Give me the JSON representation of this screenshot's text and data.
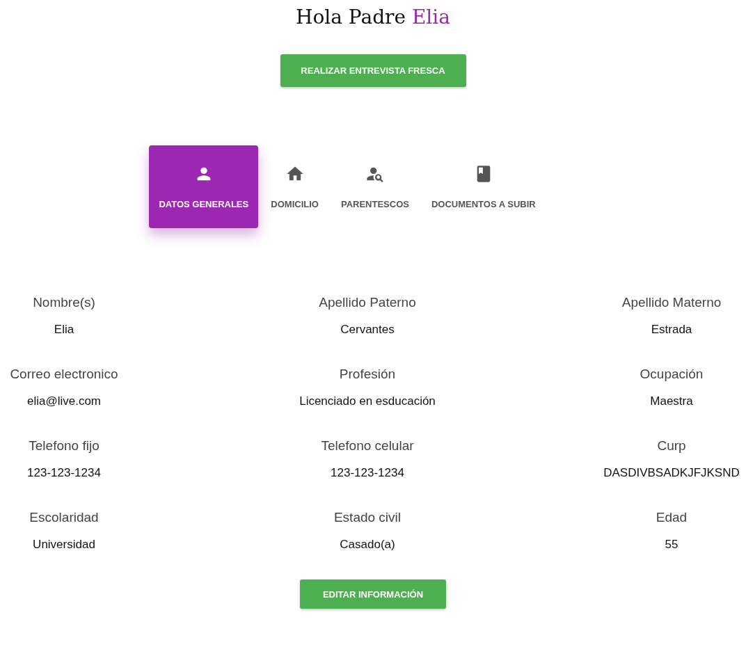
{
  "greeting": {
    "text": "Hola Padre",
    "name": "Elia"
  },
  "interview_button": "REALIZAR ENTREVISTA FRESCA",
  "tabs": [
    {
      "label": "DATOS GENERALES",
      "kind": "person",
      "selected": true
    },
    {
      "label": "DOMICILIO",
      "kind": "home",
      "selected": false
    },
    {
      "label": "PARENTESCOS",
      "kind": "person-search",
      "selected": false
    },
    {
      "label": "DOCUMENTOS A SUBIR",
      "kind": "book",
      "selected": false
    }
  ],
  "fields": [
    {
      "label": "Nombre(s)",
      "value": "Elia"
    },
    {
      "label": "Apellido Paterno",
      "value": "Cervantes"
    },
    {
      "label": "Apellido Materno",
      "value": "Estrada"
    },
    {
      "label": "Correo electronico",
      "value": "elia@live.com"
    },
    {
      "label": "Profesión",
      "value": "Licenciado en esducación"
    },
    {
      "label": "Ocupación",
      "value": "Maestra"
    },
    {
      "label": "Telefono fijo",
      "value": "123-123-1234"
    },
    {
      "label": "Telefono celular",
      "value": "123-123-1234"
    },
    {
      "label": "Curp",
      "value": "DASDIVBSADKJFJKSND"
    },
    {
      "label": "Escolaridad",
      "value": "Universidad"
    },
    {
      "label": "Estado civil",
      "value": "Casado(a)"
    },
    {
      "label": "Edad",
      "value": "55"
    }
  ],
  "edit_button": "EDITAR INFORMACIÓN"
}
